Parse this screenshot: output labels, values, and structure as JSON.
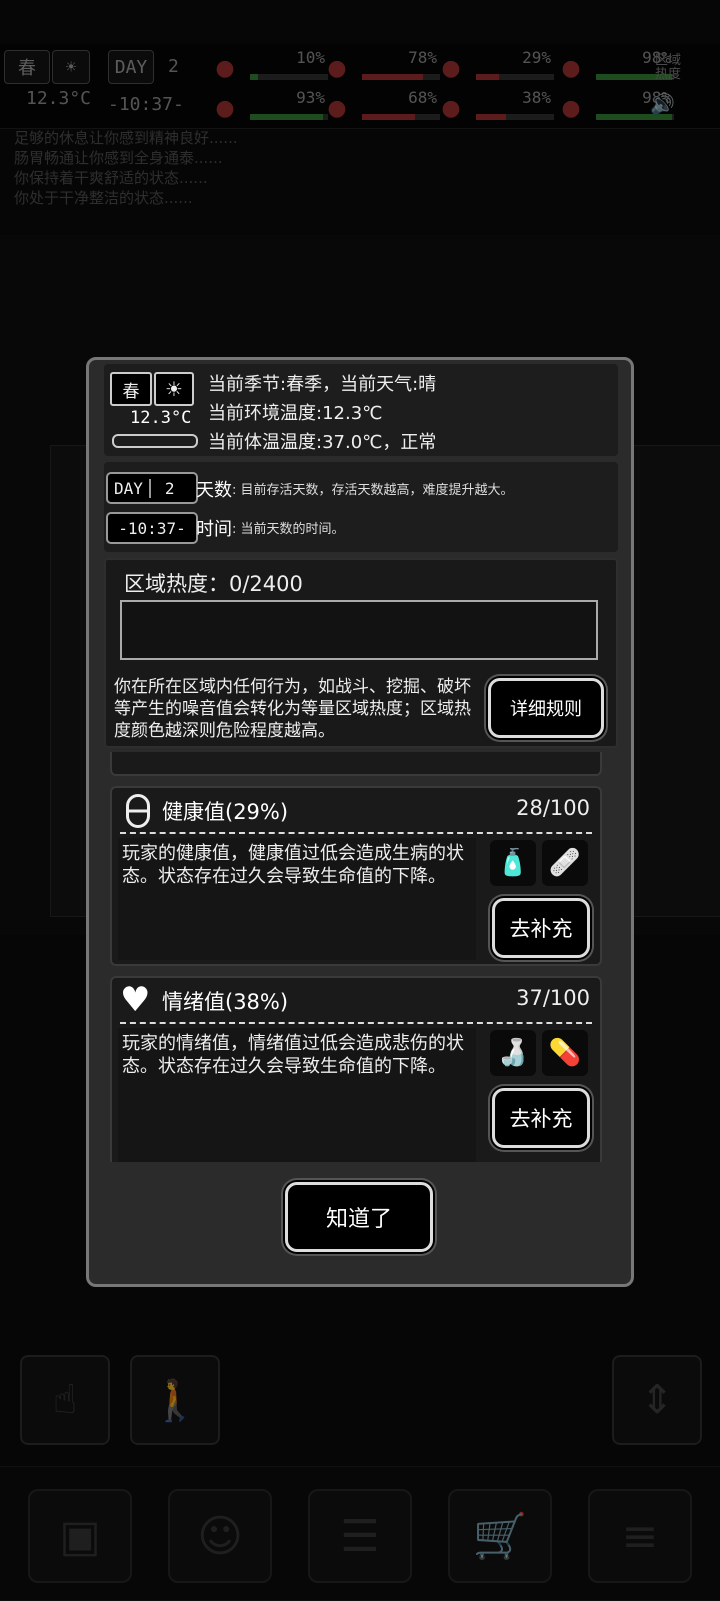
{
  "hud": {
    "season": "春",
    "day_label": "DAY",
    "day_value": "2",
    "temperature": "12.3°C",
    "time": "-10:37-",
    "region_label": "区域热度",
    "stats_row1": [
      {
        "name": "stamina-icon",
        "value": "10%",
        "fill": 0.1,
        "color": "#3a8a3a"
      },
      {
        "name": "stomach-icon",
        "value": "78%",
        "fill": 0.78,
        "color": "#a33"
      },
      {
        "name": "health-pill-icon",
        "value": "29%",
        "fill": 0.29,
        "color": "#a33"
      },
      {
        "name": "clean-icon",
        "value": "98%",
        "fill": 0.98,
        "color": "#3a8a3a"
      }
    ],
    "stats_row2": [
      {
        "name": "brain-icon",
        "value": "93%",
        "fill": 0.93,
        "color": "#3a8a3a"
      },
      {
        "name": "water-icon",
        "value": "68%",
        "fill": 0.68,
        "color": "#a33"
      },
      {
        "name": "heart-icon",
        "value": "38%",
        "fill": 0.38,
        "color": "#a33"
      },
      {
        "name": "energy-icon",
        "value": "98%",
        "fill": 0.98,
        "color": "#3a8a3a"
      }
    ]
  },
  "log": [
    "足够的休息让你感到精神良好......",
    "肠胃畅通让你感到全身通泰......",
    "你保持着干爽舒适的状态......",
    "你处于干净整洁的状态......"
  ],
  "dialog": {
    "season_line": "当前季节:春季，当前天气:晴",
    "env_temp_line": "当前环境温度:12.3℃",
    "body_temp_line": "当前体温温度:37.0℃，正常",
    "weather_box": {
      "season": "春",
      "temp": "12.3°C"
    },
    "day": {
      "lcd_label": "DAY",
      "lcd_value": "2",
      "title": "天数",
      "desc": ": 目前存活天数，存活天数越高，难度提升越大。"
    },
    "time": {
      "lcd_value": "-10:37-",
      "title": "时间",
      "desc": ": 当前天数的时间。"
    },
    "heat": {
      "title": "区域热度：0/2400",
      "fill": 0,
      "desc": "你在所在区域内任何行为，如战斗、挖掘、破坏等产生的噪音值会转化为等量区域热度；区域热度颜色越深则危险程度越高。",
      "rules_button": "详细规则"
    },
    "cards": [
      {
        "icon": "health-pill-icon",
        "title": "健康值(29%)",
        "value": "28/100",
        "desc": "玩家的健康值，健康值过低会造成生病的状态。状态存在过久会导致生命值的下降。",
        "items": [
          "medicine-spray-icon",
          "bandage-icon"
        ],
        "button": "去补充"
      },
      {
        "icon": "heart-icon",
        "title": "情绪值(38%)",
        "value": "37/100",
        "desc": "玩家的情绪值，情绪值过低会造成悲伤的状态。状态存在过久会导致生命值的下降。",
        "items": [
          "bottle-icon",
          "pills-icon"
        ],
        "button": "去补充"
      }
    ],
    "ok_button": "知道了"
  }
}
